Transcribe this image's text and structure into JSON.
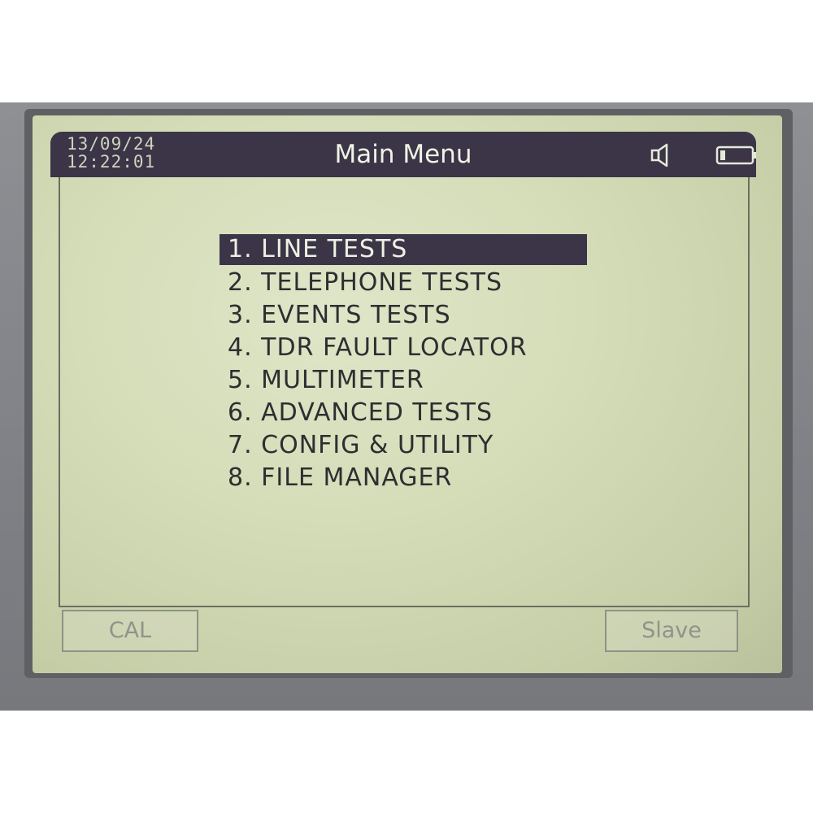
{
  "header": {
    "date": "13/09/24",
    "time": "12:22:01",
    "title": "Main Menu",
    "icons": [
      "speaker-icon",
      "battery-icon"
    ]
  },
  "menu": {
    "selected_index": 0,
    "items": [
      {
        "label": "1. LINE TESTS"
      },
      {
        "label": "2. TELEPHONE TESTS"
      },
      {
        "label": "3. EVENTS TESTS"
      },
      {
        "label": "4. TDR FAULT LOCATOR"
      },
      {
        "label": "5. MULTIMETER"
      },
      {
        "label": "6. ADVANCED TESTS"
      },
      {
        "label": "7. CONFIG & UTILITY"
      },
      {
        "label": "8. FILE MANAGER"
      }
    ]
  },
  "softkeys": {
    "left": "CAL",
    "right": "Slave"
  },
  "colors": {
    "header_bg": "#3b3547",
    "screen_bg": "#d3dbb6",
    "text": "#2e2e31",
    "softkey_text": "#8f9488"
  }
}
